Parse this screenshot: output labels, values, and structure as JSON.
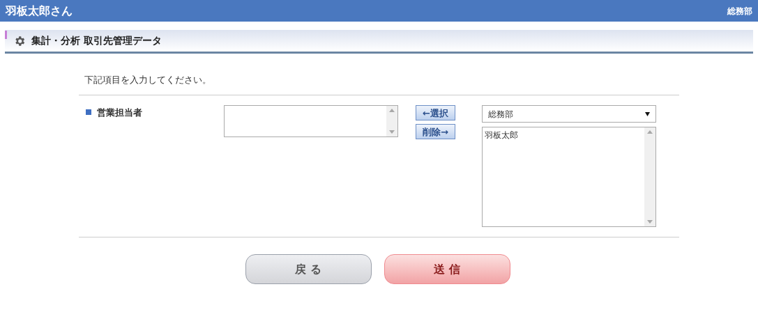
{
  "header": {
    "user": "羽板太郎さん",
    "department": "総務部"
  },
  "section_title": "集計・分析 取引先管理データ",
  "instruction": "下記項目を入力してください。",
  "field": {
    "label": "営業担当者",
    "select_button": "←選択",
    "remove_button": "削除→",
    "group_select": "総務部",
    "candidates": [
      {
        "name": "羽板太郎",
        "selected": false
      }
    ]
  },
  "buttons": [
    {
      "label": "戻 る",
      "kind": "back"
    },
    {
      "label": "送 信",
      "kind": "submit"
    }
  ]
}
